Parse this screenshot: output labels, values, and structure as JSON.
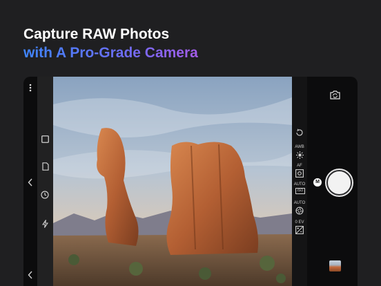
{
  "headline": {
    "line1": "Capture RAW Photos",
    "line2": "with A Pro-Grade Camera"
  },
  "camera": {
    "settings": {
      "white_balance": "AWB",
      "focus": "AF",
      "iso_mode": "AUTO",
      "iso": "ISO",
      "shutter_mode": "AUTO",
      "exposure": "0 EV"
    },
    "mode_badge": "M"
  },
  "colors": {
    "background": "#1f1f21",
    "headline_gradient_start": "#3f86ff",
    "headline_gradient_end": "#a35be8"
  },
  "icons": {
    "menu": "vertical-dots-icon",
    "switch_camera": "camera-rotate-icon",
    "left_tools": [
      "square-icon",
      "document-icon",
      "timer-icon",
      "flash-icon"
    ]
  }
}
